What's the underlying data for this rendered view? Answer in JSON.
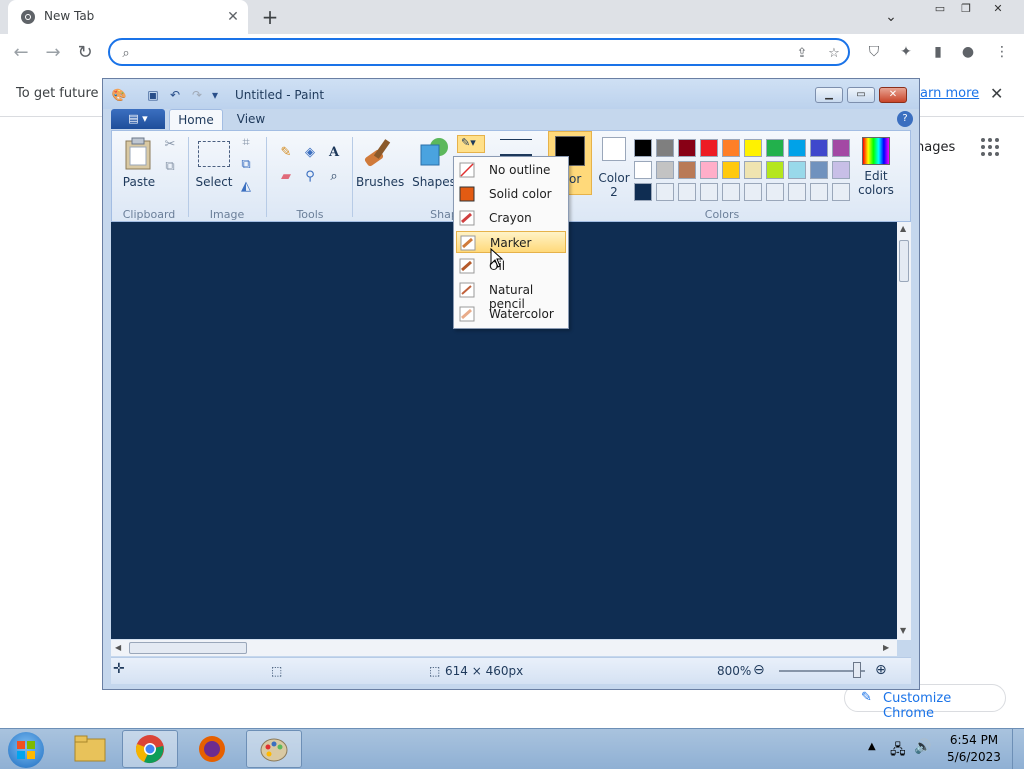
{
  "browser": {
    "tab_title": "New Tab",
    "omnibox_value": "",
    "info_text": "To get future G",
    "info_link": "earn more",
    "images_link": "nages",
    "customize_label": "Customize Chrome"
  },
  "paint": {
    "title": "Untitled - Paint",
    "tabs": [
      "Home",
      "View"
    ],
    "groups": {
      "clipboard": "Clipboard",
      "image": "Image",
      "tools": "Tools",
      "shapes": "Shap",
      "colors": "Colors"
    },
    "buttons": {
      "paste": "Paste",
      "select": "Select",
      "brushes": "Brushes",
      "shapes": "Shapes",
      "color1": "or",
      "color2_line1": "Color",
      "color2_line2": "2",
      "edit_colors_line1": "Edit",
      "edit_colors_line2": "colors"
    },
    "palette_row1": [
      "#000000",
      "#7f7f7f",
      "#880015",
      "#ed1c24",
      "#ff7f27",
      "#fff200",
      "#22b14c",
      "#00a2e8",
      "#3f48cc",
      "#a349a4"
    ],
    "palette_row2": [
      "#ffffff",
      "#c3c3c3",
      "#b97a57",
      "#ffaec9",
      "#ffc90e",
      "#efe4b0",
      "#b5e61d",
      "#99d9ea",
      "#7092be",
      "#c8bfe7"
    ],
    "palette_row3": [
      "#0f2d52",
      "#e8eef6",
      "#e8eef6",
      "#e8eef6",
      "#e8eef6",
      "#e8eef6",
      "#e8eef6",
      "#e8eef6",
      "#e8eef6",
      "#e8eef6"
    ],
    "canvas_color": "#0f2d52",
    "status": {
      "size": "614 × 460px",
      "zoom": "800%"
    },
    "menu": {
      "items": [
        "No outline",
        "Solid color",
        "Crayon",
        "Marker",
        "Oil",
        "Natural pencil",
        "Watercolor"
      ],
      "highlighted": "Marker"
    }
  },
  "taskbar": {
    "time": "6:54 PM",
    "date": "5/6/2023"
  }
}
